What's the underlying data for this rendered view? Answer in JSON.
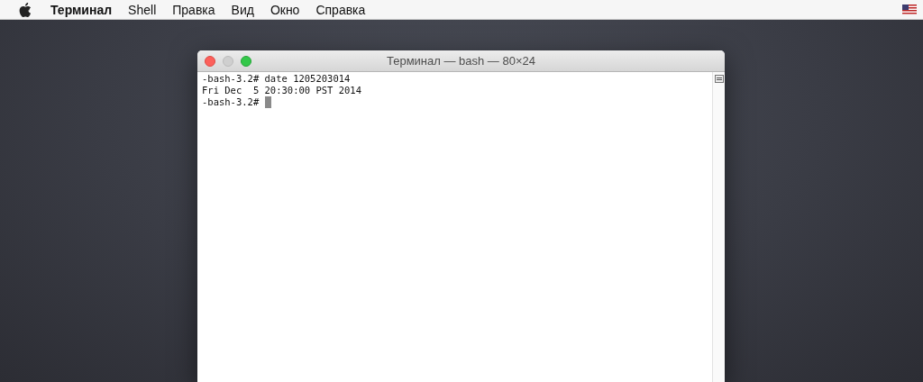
{
  "menu_bar": {
    "app_name": "Терминал",
    "items": [
      "Shell",
      "Правка",
      "Вид",
      "Окно",
      "Справка"
    ]
  },
  "window": {
    "title": "Терминал — bash — 80×24",
    "lines": [
      {
        "text": "-bash-3.2# date 1205203014"
      },
      {
        "text": "Fri Dec  5 20:30:00 PST 2014"
      },
      {
        "text": "-bash-3.2# ",
        "cursor": true
      }
    ]
  }
}
